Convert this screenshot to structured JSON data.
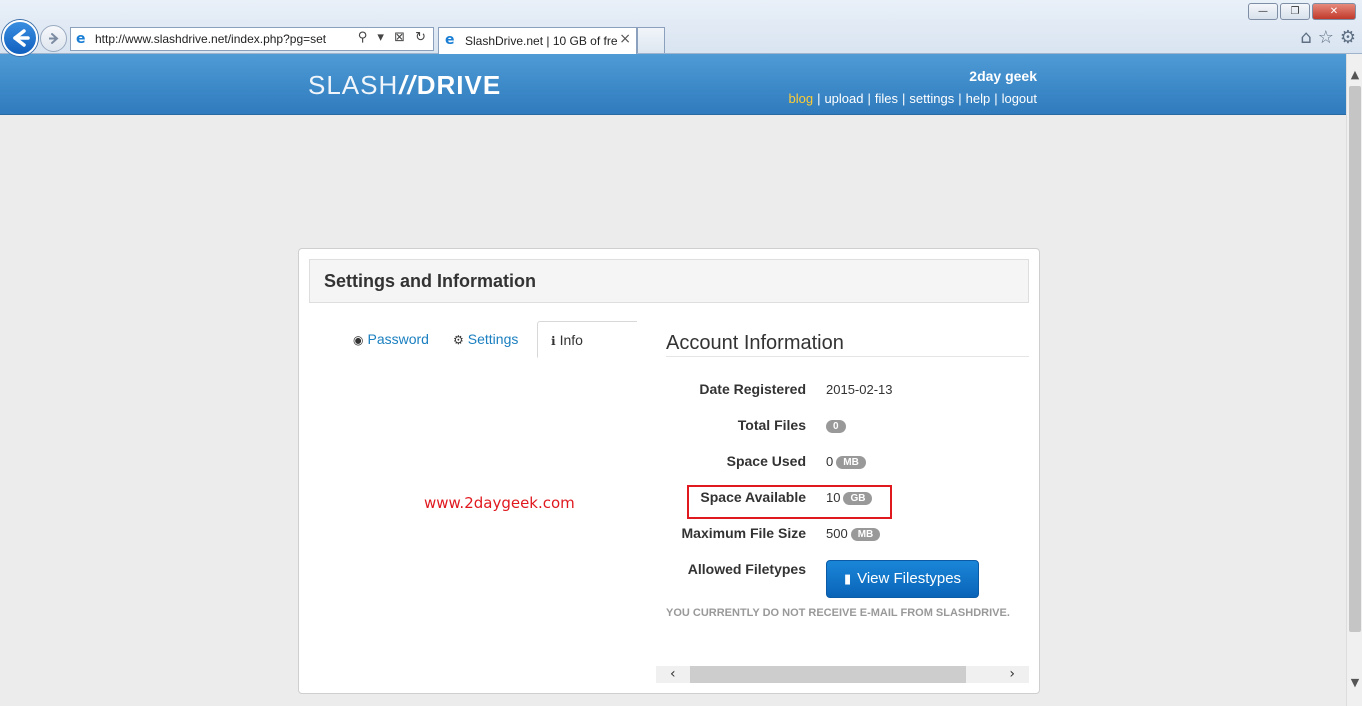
{
  "browser": {
    "address_url": "http://www.slashdrive.net/index.php?pg=set",
    "address_icons": "⚲ ▾ ⊠ ↻",
    "tab_title": "SlashDrive.net | 10 GB of fre...",
    "tab_close": "×",
    "window_buttons": {
      "minimize": "—",
      "maximize": "❐",
      "close": "✕"
    },
    "icons": {
      "home": "⌂",
      "favorites": "☆",
      "tools": "⚙"
    }
  },
  "site": {
    "logo_part1": "SLASH",
    "logo_sep": "//",
    "logo_part2": "DRIVE",
    "username": "2day geek",
    "nav": [
      "blog",
      "upload",
      "files",
      "settings",
      "help",
      "logout"
    ],
    "nav_active": "blog"
  },
  "card": {
    "title": "Settings and Information",
    "tabs": [
      {
        "label": "Password",
        "icon": "eye-slash-icon"
      },
      {
        "label": "Settings",
        "icon": "gear-icon"
      },
      {
        "label": "Info",
        "icon": "info-circle-icon"
      }
    ],
    "active_tab": "Info"
  },
  "watermark": "www.2daygeek.com",
  "account": {
    "title": "Account Information",
    "date_registered_label": "Date Registered",
    "date_registered": "2015-02-13",
    "total_files_label": "Total Files",
    "total_files": "0",
    "space_used_label": "Space Used",
    "space_used": "0",
    "space_used_unit": "MB",
    "space_available_label": "Space Available",
    "space_available": "10",
    "space_available_unit": "GB",
    "max_file_size_label": "Maximum File Size",
    "max_file_size": "500",
    "max_file_size_unit": "MB",
    "allowed_filetypes_label": "Allowed Filetypes",
    "view_filetypes_button": "View Filestypes",
    "email_note": "YOU CURRENTLY DO NOT RECEIVE E-MAIL FROM SLASHDRIVE."
  },
  "colors": {
    "header_blue": "#3a89cc",
    "accent_yellow": "#ffcc33",
    "link_blue": "#1a7fc0",
    "highlight_red": "#e0191f",
    "button_blue": "#0f72c6"
  }
}
